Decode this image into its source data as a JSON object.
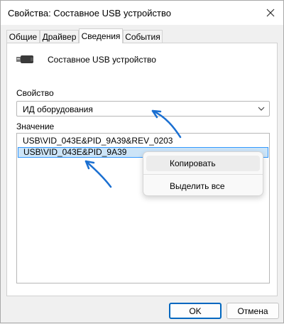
{
  "window": {
    "title": "Свойства: Составное USB устройство",
    "close_icon": "close-icon"
  },
  "tabs": [
    {
      "label": "Общие"
    },
    {
      "label": "Драйвер"
    },
    {
      "label": "Сведения"
    },
    {
      "label": "События"
    }
  ],
  "device": {
    "name": "Составное USB устройство",
    "icon": "usb-plug-icon"
  },
  "property": {
    "label": "Свойство",
    "selected": "ИД оборудования"
  },
  "values": {
    "label": "Значение",
    "items": [
      "USB\\VID_043E&PID_9A39&REV_0203",
      "USB\\VID_043E&PID_9A39"
    ]
  },
  "context_menu": {
    "items": [
      {
        "label": "Копировать"
      },
      {
        "label": "Выделить все"
      }
    ]
  },
  "buttons": {
    "ok": "OK",
    "cancel": "Отмена"
  },
  "colors": {
    "accent": "#0067c0",
    "selection": "#cce4f7",
    "arrow": "#1a6fd1"
  }
}
